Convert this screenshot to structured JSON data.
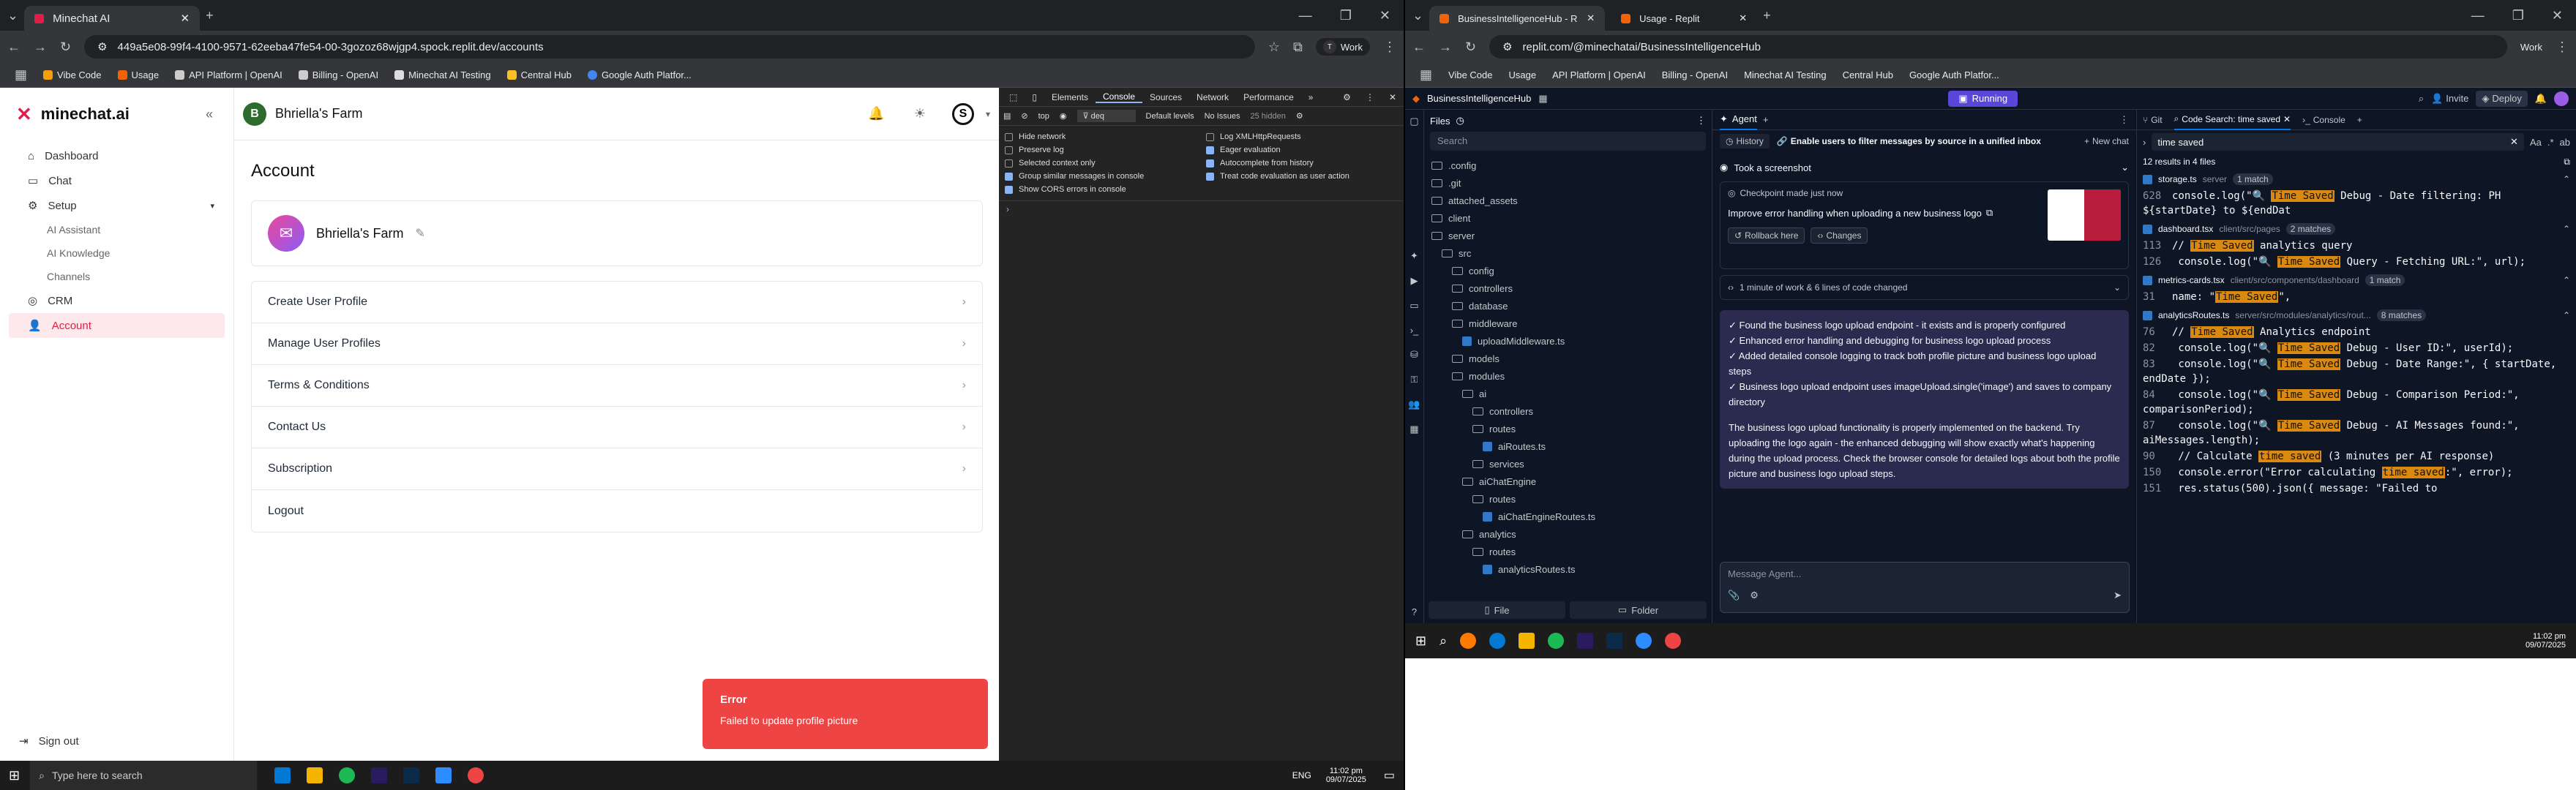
{
  "left_browser": {
    "tab_title": "Minechat AI",
    "url": "449a5e08-99f4-4100-9571-62eeba47fe54-00-3gozoz68wjgp4.spock.replit.dev/accounts",
    "profile_label": "Work",
    "bookmarks": [
      "Vibe Code",
      "Usage",
      "API Platform | OpenAI",
      "Billing - OpenAI",
      "Minechat AI Testing",
      "Central Hub",
      "Google Auth Platfor..."
    ]
  },
  "app": {
    "logo": "minechat.ai",
    "collapse_icon": "«",
    "farm_name": "Bhriella's Farm",
    "avatar_letter": "S",
    "sidebar": {
      "dashboard": "Dashboard",
      "chat": "Chat",
      "setup": "Setup",
      "setup_children": [
        "AI Assistant",
        "AI Knowledge",
        "Channels"
      ],
      "crm": "CRM",
      "account": "Account",
      "signout": "Sign out"
    },
    "page_title": "Account",
    "profile_name": "Bhriella's Farm",
    "menu": [
      "Create User Profile",
      "Manage User Profiles",
      "Terms & Conditions",
      "Contact Us",
      "Subscription",
      "Logout"
    ],
    "toast": {
      "title": "Error",
      "message": "Failed to update profile picture"
    }
  },
  "devtools": {
    "tabs": [
      "Elements",
      "Console",
      "Sources",
      "Network",
      "Performance"
    ],
    "active_tab": "Console",
    "context": "top",
    "filter": "deq",
    "levels": "Default levels",
    "issues": "No Issues",
    "hidden": "25 hidden",
    "settings_left": [
      {
        "label": "Hide network",
        "on": false
      },
      {
        "label": "Preserve log",
        "on": false
      },
      {
        "label": "Selected context only",
        "on": false
      },
      {
        "label": "Group similar messages in console",
        "on": true
      },
      {
        "label": "Show CORS errors in console",
        "on": true
      }
    ],
    "settings_right": [
      {
        "label": "Log XMLHttpRequests",
        "on": false
      },
      {
        "label": "Eager evaluation",
        "on": true
      },
      {
        "label": "Autocomplete from history",
        "on": true
      },
      {
        "label": "Treat code evaluation as user action",
        "on": true
      }
    ]
  },
  "taskbar_left": {
    "search_placeholder": "Type here to search",
    "lang": "ENG",
    "time": "11:02 pm",
    "date": "09/07/2025"
  },
  "right_browser": {
    "tabs": [
      "BusinessIntelligenceHub - Repli",
      "Usage - Replit"
    ],
    "url": "replit.com/@minechatai/BusinessIntelligenceHub",
    "profile_label": "Work",
    "bookmarks": [
      "Vibe Code",
      "Usage",
      "API Platform | OpenAI",
      "Billing - OpenAI",
      "Minechat AI Testing",
      "Central Hub",
      "Google Auth Platfor..."
    ]
  },
  "replit": {
    "project": "BusinessIntelligenceHub",
    "status": "Running",
    "invite": "Invite",
    "deploy": "Deploy",
    "files_title": "Files",
    "search_placeholder": "Search",
    "tree": [
      {
        "name": ".config",
        "depth": 0,
        "type": "folder"
      },
      {
        "name": ".git",
        "depth": 0,
        "type": "folder"
      },
      {
        "name": "attached_assets",
        "depth": 0,
        "type": "folder"
      },
      {
        "name": "client",
        "depth": 0,
        "type": "folder"
      },
      {
        "name": "server",
        "depth": 0,
        "type": "folder"
      },
      {
        "name": "src",
        "depth": 1,
        "type": "folder"
      },
      {
        "name": "config",
        "depth": 2,
        "type": "folder"
      },
      {
        "name": "controllers",
        "depth": 2,
        "type": "folder"
      },
      {
        "name": "database",
        "depth": 2,
        "type": "folder"
      },
      {
        "name": "middleware",
        "depth": 2,
        "type": "folder"
      },
      {
        "name": "uploadMiddleware.ts",
        "depth": 3,
        "type": "file"
      },
      {
        "name": "models",
        "depth": 2,
        "type": "folder"
      },
      {
        "name": "modules",
        "depth": 2,
        "type": "folder"
      },
      {
        "name": "ai",
        "depth": 3,
        "type": "folder"
      },
      {
        "name": "controllers",
        "depth": 4,
        "type": "folder"
      },
      {
        "name": "routes",
        "depth": 4,
        "type": "folder"
      },
      {
        "name": "aiRoutes.ts",
        "depth": 5,
        "type": "file"
      },
      {
        "name": "services",
        "depth": 4,
        "type": "folder"
      },
      {
        "name": "aiChatEngine",
        "depth": 3,
        "type": "folder"
      },
      {
        "name": "routes",
        "depth": 4,
        "type": "folder"
      },
      {
        "name": "aiChatEngineRoutes.ts",
        "depth": 5,
        "type": "file"
      },
      {
        "name": "analytics",
        "depth": 3,
        "type": "folder"
      },
      {
        "name": "routes",
        "depth": 4,
        "type": "folder"
      },
      {
        "name": "analyticsRoutes.ts",
        "depth": 5,
        "type": "file"
      }
    ],
    "file_btn": "File",
    "folder_btn": "Folder",
    "agent_tab": "Agent",
    "history": "History",
    "thread_title": "Enable users to filter messages by source in a unified inbox",
    "new_chat": "New chat",
    "screenshot_label": "Took a screenshot",
    "checkpoint": "Checkpoint made just now",
    "checkpoint_title": "Improve error handling when uploading a new business logo",
    "rollback": "Rollback here",
    "changes": "Changes",
    "work_summary": "1 minute of work & 6 lines of code changed",
    "bullets": [
      "✓ Found the business logo upload endpoint - it exists and is properly configured",
      "✓ Enhanced error handling and debugging for business logo upload process",
      "✓ Added detailed console logging to track both profile picture and business logo upload steps",
      "✓ Business logo upload endpoint uses imageUpload.single('image') and saves to company directory"
    ],
    "paragraph": "The business logo upload functionality is properly implemented on the backend. Try uploading the logo again - the enhanced debugging will show exactly what's happening during the upload process. Check the browser console for detailed logs about both the profile picture and business logo upload steps.",
    "message_placeholder": "Message Agent...",
    "right_tabs": [
      "Git",
      "Code Search: time saved",
      "Console"
    ],
    "search_query": "time saved",
    "results_summary": "12 results in 4 files",
    "results": [
      {
        "file": "storage.ts",
        "path": "server",
        "count": "1 match",
        "lines": [
          {
            "n": "628",
            "pre": "console.log(\"🔍 ",
            "hl": "Time Saved",
            "post": " Debug - Date filtering: PH ${startDate} to ${endDat"
          }
        ]
      },
      {
        "file": "dashboard.tsx",
        "path": "client/src/pages",
        "count": "2 matches",
        "lines": [
          {
            "n": "113",
            "pre": "// ",
            "hl": "Time Saved",
            "post": " analytics query"
          },
          {
            "n": "126",
            "pre": "  console.log(\"🔍 ",
            "hl": "Time Saved",
            "post": " Query - Fetching URL:\", url);"
          }
        ]
      },
      {
        "file": "metrics-cards.tsx",
        "path": "client/src/components/dashboard",
        "count": "1 match",
        "lines": [
          {
            "n": "31",
            "pre": "name: \"",
            "hl": "Time Saved",
            "post": "\","
          }
        ]
      },
      {
        "file": "analyticsRoutes.ts",
        "path": "server/src/modules/analytics/rout...",
        "count": "8 matches",
        "lines": [
          {
            "n": "76",
            "pre": "// ",
            "hl": "Time Saved",
            "post": " Analytics endpoint"
          },
          {
            "n": "82",
            "pre": "    console.log(\"🔍 ",
            "hl": "Time Saved",
            "post": " Debug - User ID:\", userId);"
          },
          {
            "n": "83",
            "pre": "    console.log(\"🔍 ",
            "hl": "Time Saved",
            "post": " Debug - Date Range:\", { startDate, endDate });"
          },
          {
            "n": "84",
            "pre": "    console.log(\"🔍 ",
            "hl": "Time Saved",
            "post": " Debug - Comparison Period:\", comparisonPeriod);"
          },
          {
            "n": "87",
            "pre": "    console.log(\"🔍 ",
            "hl": "Time Saved",
            "post": " Debug - AI Messages found:\", aiMessages.length);"
          },
          {
            "n": "90",
            "pre": "    // Calculate ",
            "hl": "time saved",
            "post": " (3 minutes per AI response)"
          },
          {
            "n": "150",
            "pre": "    console.error(\"Error calculating ",
            "hl": "time saved",
            "post": ":\", error);"
          },
          {
            "n": "151",
            "pre": "    res.status(500).json({ message: \"Failed to",
            "hl": "",
            "post": ""
          }
        ]
      }
    ]
  },
  "taskbar_right": {
    "time": "11:02 pm",
    "date": "09/07/2025"
  },
  "colors": {
    "accent": "#e11d48",
    "toast": "#ef4444",
    "replit_bg": "#0e1525",
    "running": "#5a46d8",
    "highlight": "#d9890f"
  }
}
